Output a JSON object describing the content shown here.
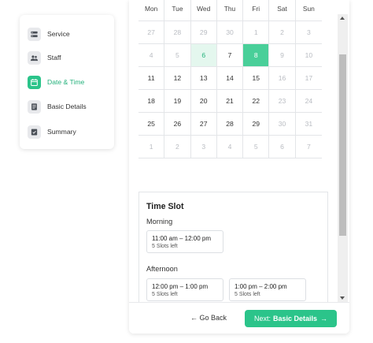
{
  "steps": [
    {
      "label": "Service",
      "icon": "service-icon",
      "active": false
    },
    {
      "label": "Staff",
      "icon": "staff-icon",
      "active": false
    },
    {
      "label": "Date & Time",
      "icon": "calendar-icon",
      "active": true
    },
    {
      "label": "Basic Details",
      "icon": "document-icon",
      "active": false
    },
    {
      "label": "Summary",
      "icon": "checklist-icon",
      "active": false
    }
  ],
  "calendar": {
    "weekdays": [
      "Mon",
      "Tue",
      "Wed",
      "Thu",
      "Fri",
      "Sat",
      "Sun"
    ],
    "days": [
      {
        "d": "27",
        "s": "muted"
      },
      {
        "d": "28",
        "s": "muted"
      },
      {
        "d": "29",
        "s": "muted"
      },
      {
        "d": "30",
        "s": "muted"
      },
      {
        "d": "1",
        "s": "muted"
      },
      {
        "d": "2",
        "s": "muted"
      },
      {
        "d": "3",
        "s": "muted"
      },
      {
        "d": "4",
        "s": "muted"
      },
      {
        "d": "5",
        "s": "muted"
      },
      {
        "d": "6",
        "s": "available"
      },
      {
        "d": "7",
        "s": "normal"
      },
      {
        "d": "8",
        "s": "selected"
      },
      {
        "d": "9",
        "s": "muted"
      },
      {
        "d": "10",
        "s": "muted"
      },
      {
        "d": "11",
        "s": "normal"
      },
      {
        "d": "12",
        "s": "normal"
      },
      {
        "d": "13",
        "s": "normal"
      },
      {
        "d": "14",
        "s": "normal"
      },
      {
        "d": "15",
        "s": "normal"
      },
      {
        "d": "16",
        "s": "muted"
      },
      {
        "d": "17",
        "s": "muted"
      },
      {
        "d": "18",
        "s": "normal"
      },
      {
        "d": "19",
        "s": "normal"
      },
      {
        "d": "20",
        "s": "normal"
      },
      {
        "d": "21",
        "s": "normal"
      },
      {
        "d": "22",
        "s": "normal"
      },
      {
        "d": "23",
        "s": "muted"
      },
      {
        "d": "24",
        "s": "muted"
      },
      {
        "d": "25",
        "s": "normal"
      },
      {
        "d": "26",
        "s": "normal"
      },
      {
        "d": "27",
        "s": "normal"
      },
      {
        "d": "28",
        "s": "normal"
      },
      {
        "d": "29",
        "s": "normal"
      },
      {
        "d": "30",
        "s": "muted"
      },
      {
        "d": "31",
        "s": "muted"
      },
      {
        "d": "1",
        "s": "muted"
      },
      {
        "d": "2",
        "s": "muted"
      },
      {
        "d": "3",
        "s": "muted"
      },
      {
        "d": "4",
        "s": "muted"
      },
      {
        "d": "5",
        "s": "muted"
      },
      {
        "d": "6",
        "s": "muted"
      },
      {
        "d": "7",
        "s": "muted"
      }
    ]
  },
  "timeslot": {
    "title": "Time Slot",
    "morning_label": "Morning",
    "afternoon_label": "Afternoon",
    "morning": [
      {
        "time": "11:00 am – 12:00 pm",
        "slots": "5 Slots left"
      }
    ],
    "afternoon": [
      {
        "time": "12:00 pm – 1:00 pm",
        "slots": "5 Slots left"
      },
      {
        "time": "1:00 pm – 2:00 pm",
        "slots": "5 Slots left"
      }
    ]
  },
  "footer": {
    "back_label": "← Go Back",
    "next_prefix": "Next:",
    "next_label": "Basic Details",
    "next_arrow": "→"
  },
  "colors": {
    "accent": "#2bc48a",
    "accent_text": "#23b17b",
    "available_bg": "#e4f7ee",
    "selected_bg": "#49cf99"
  }
}
